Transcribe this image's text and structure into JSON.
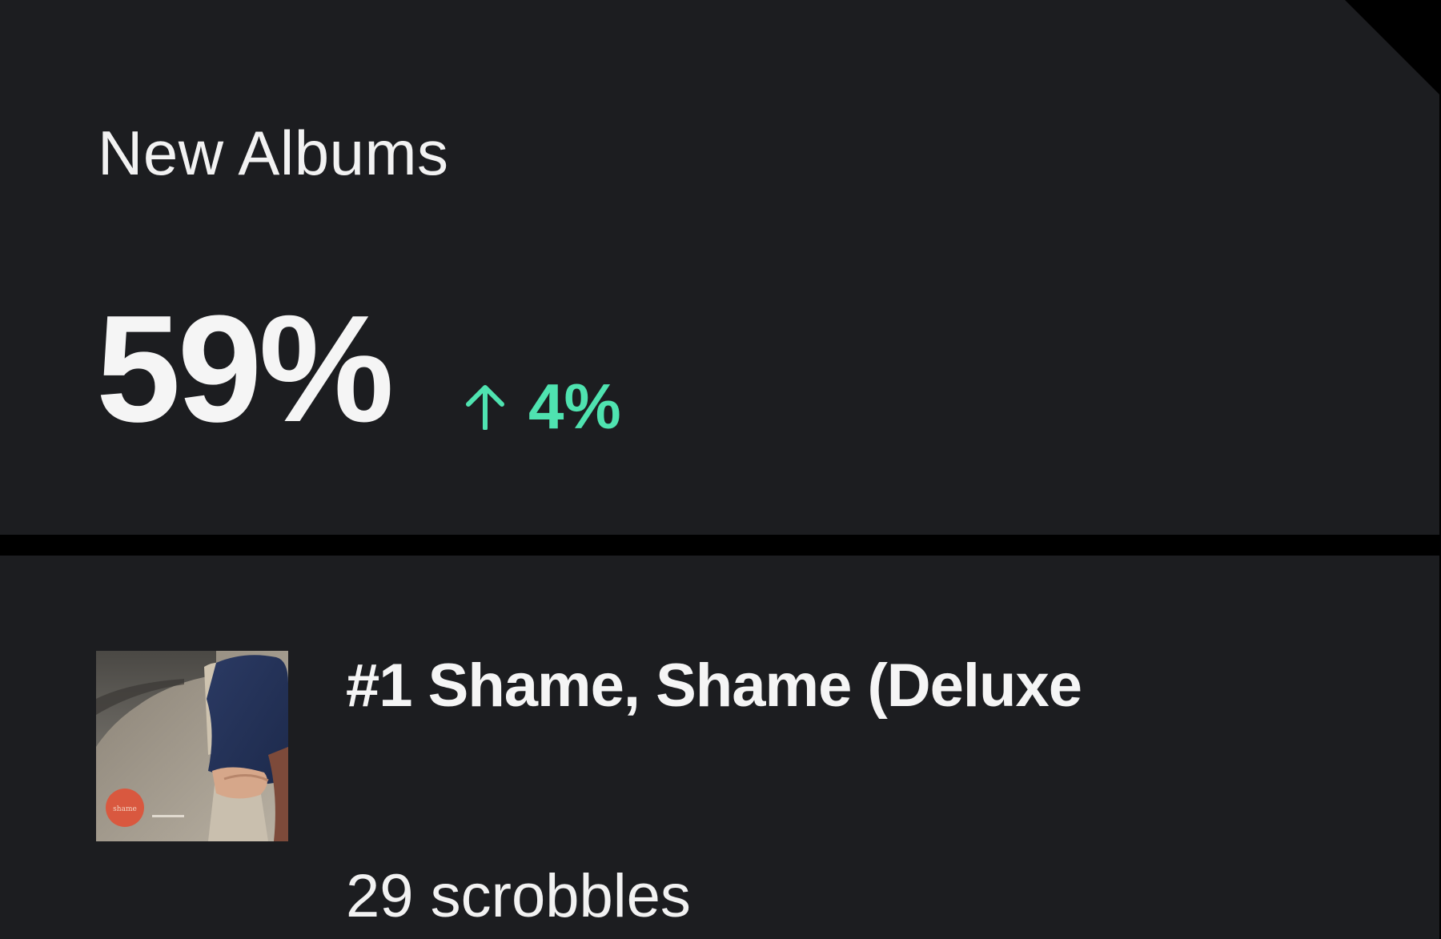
{
  "new_albums": {
    "title": "New Albums",
    "percentage": "59%",
    "percentage_value": 59,
    "change": {
      "direction": "up",
      "icon": "arrow-up-icon",
      "value": "4%",
      "color": "#4fe3b0"
    }
  },
  "top_album": {
    "rank_title": "#1 Shame, Shame (Deluxe",
    "scrobbles": "29 scrobbles",
    "art_icon": "album-cover"
  },
  "colors": {
    "background": "#000000",
    "card": "#1c1d20",
    "text": "#f5f5f5",
    "accent": "#4fe3b0"
  }
}
